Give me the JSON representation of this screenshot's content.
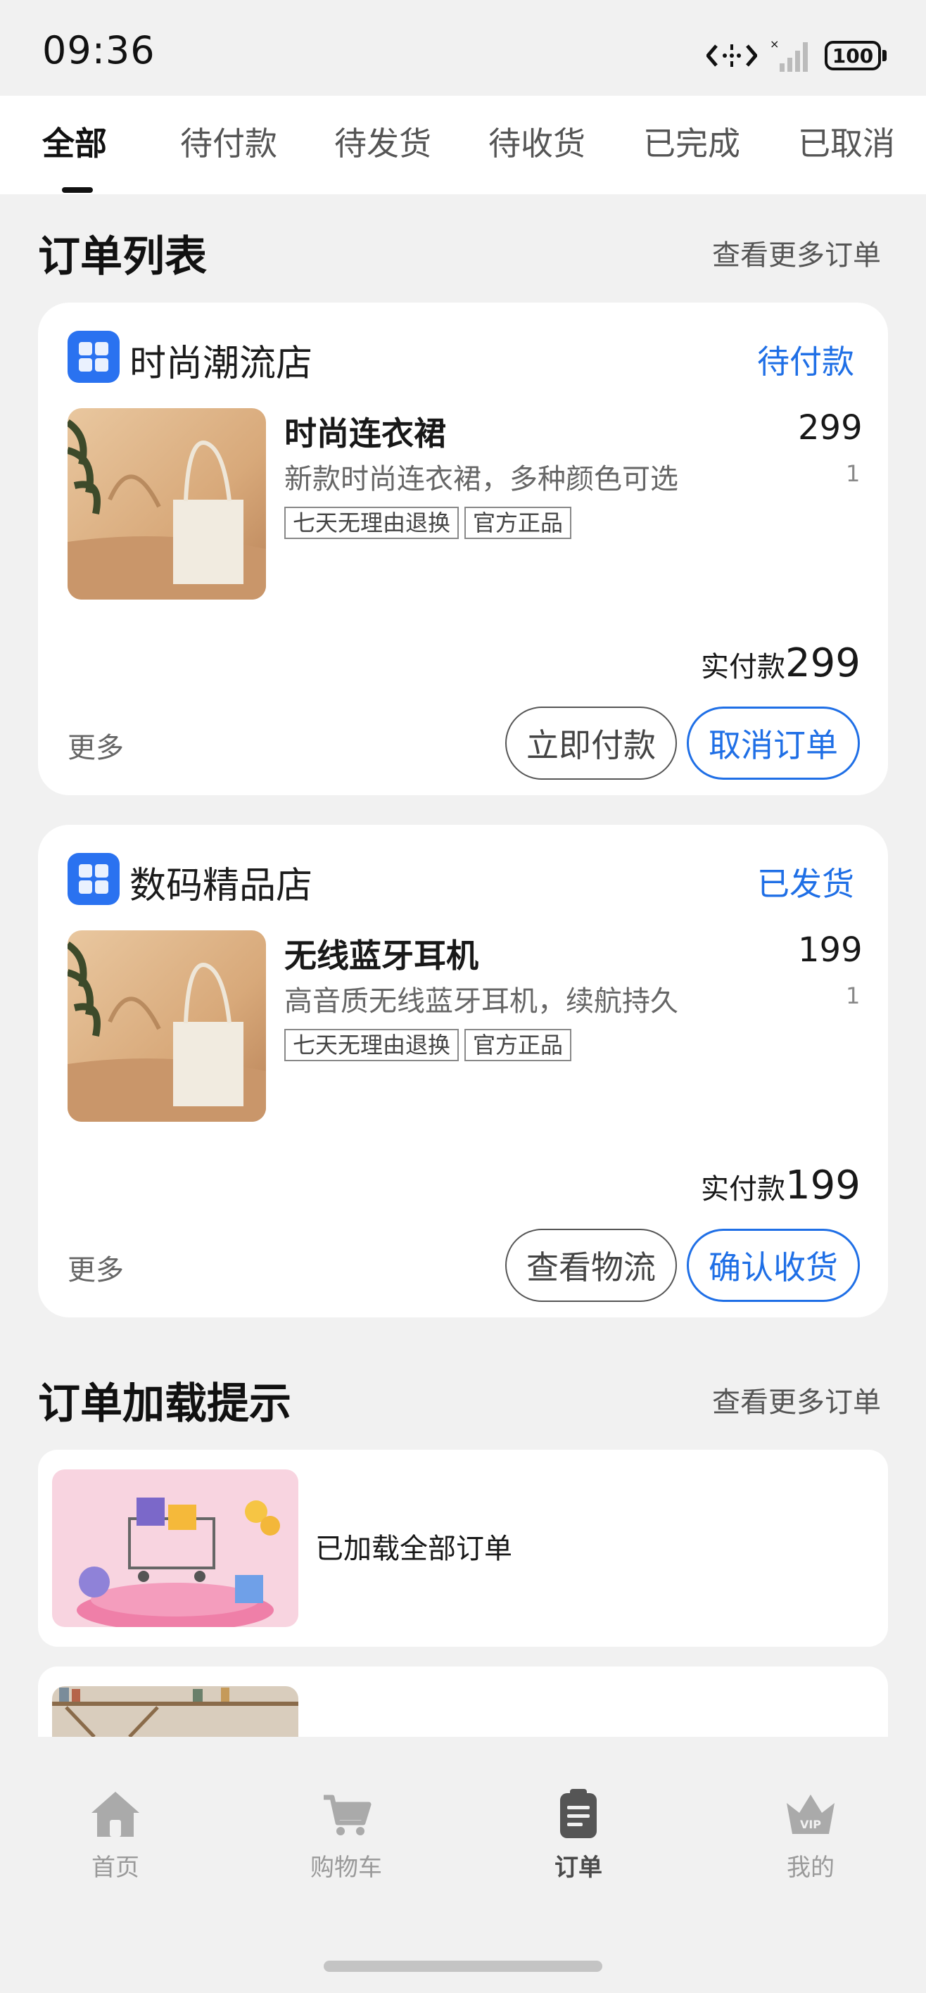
{
  "status_bar": {
    "time": "09:36",
    "battery": "100"
  },
  "tabs": [
    {
      "label": "全部",
      "active": true
    },
    {
      "label": "待付款"
    },
    {
      "label": "待发货"
    },
    {
      "label": "待收货"
    },
    {
      "label": "已完成"
    },
    {
      "label": "已取消"
    }
  ],
  "order_list": {
    "title": "订单列表",
    "more": "查看更多订单",
    "orders": [
      {
        "shop": "时尚潮流店",
        "status": "待付款",
        "product_name": "时尚连衣裙",
        "product_desc": "新款时尚连衣裙，多种颜色可选",
        "tags": [
          "七天无理由退换",
          "官方正品"
        ],
        "price": "299",
        "qty": "1",
        "paid_label": "实付款",
        "paid_amount": "299",
        "more": "更多",
        "buttons": [
          "立即付款",
          "取消订单"
        ]
      },
      {
        "shop": "数码精品店",
        "status": "已发货",
        "product_name": "无线蓝牙耳机",
        "product_desc": "高音质无线蓝牙耳机，续航持久",
        "tags": [
          "七天无理由退换",
          "官方正品"
        ],
        "price": "199",
        "qty": "1",
        "paid_label": "实付款",
        "paid_amount": "199",
        "more": "更多",
        "buttons": [
          "查看物流",
          "确认收货"
        ]
      }
    ]
  },
  "load_section": {
    "title": "订单加载提示",
    "more": "查看更多订单",
    "message": "已加载全部订单"
  },
  "bottom_nav": [
    {
      "label": "首页",
      "icon": "home-icon"
    },
    {
      "label": "购物车",
      "icon": "cart-icon"
    },
    {
      "label": "订单",
      "icon": "order-icon",
      "active": true
    },
    {
      "label": "我的",
      "icon": "vip-crown-icon"
    }
  ],
  "colors": {
    "accent": "#1f6fe6",
    "background": "#f1f1f1",
    "card": "#ffffff"
  }
}
